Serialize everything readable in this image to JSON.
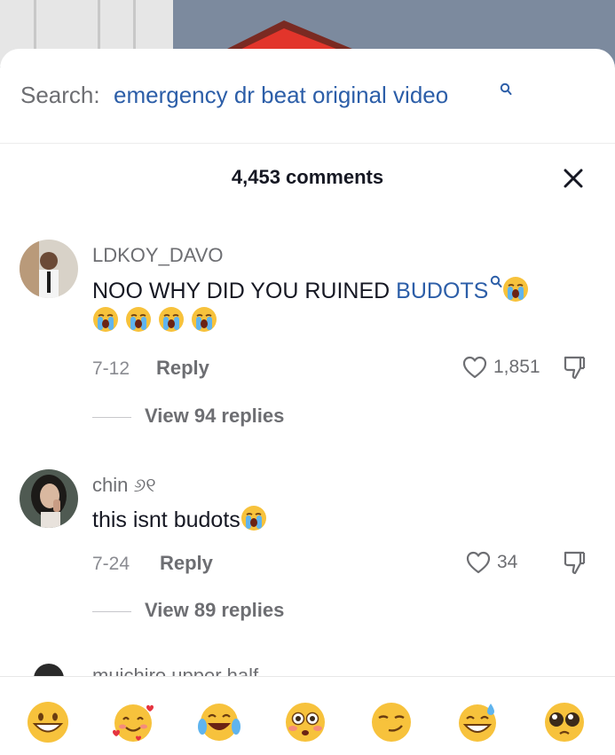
{
  "search": {
    "prefix": "Search:",
    "query": "emergency dr beat original video"
  },
  "header": {
    "comment_count": "4,453 comments"
  },
  "comments": [
    {
      "username": "LDKOY_DAVO",
      "text_before": "NOO WHY DID YOU RUINED ",
      "text_link": "BUDOTS",
      "emojis": [
        "loudly-crying-face",
        "loudly-crying-face",
        "loudly-crying-face",
        "loudly-crying-face",
        "loudly-crying-face"
      ],
      "date": "7-12",
      "reply_label": "Reply",
      "likes": "1,851",
      "view_replies": "View 94 replies"
    },
    {
      "username": "chin ୬୧",
      "text": "this isnt budots",
      "emojis": [
        "loudly-crying-face"
      ],
      "date": "7-24",
      "reply_label": "Reply",
      "likes": "34",
      "view_replies": "View 89 replies"
    }
  ],
  "peek_comment": {
    "username": "muichiro upper half"
  },
  "emoji_bar": [
    "grinning-face",
    "smiling-face-with-hearts",
    "face-with-tears-of-joy",
    "flushed-face",
    "smirking-face",
    "grinning-face-with-sweat",
    "pleading-face"
  ],
  "colors": {
    "link": "#2c5ea8",
    "text": "#161823",
    "muted": "#6d6e72"
  }
}
